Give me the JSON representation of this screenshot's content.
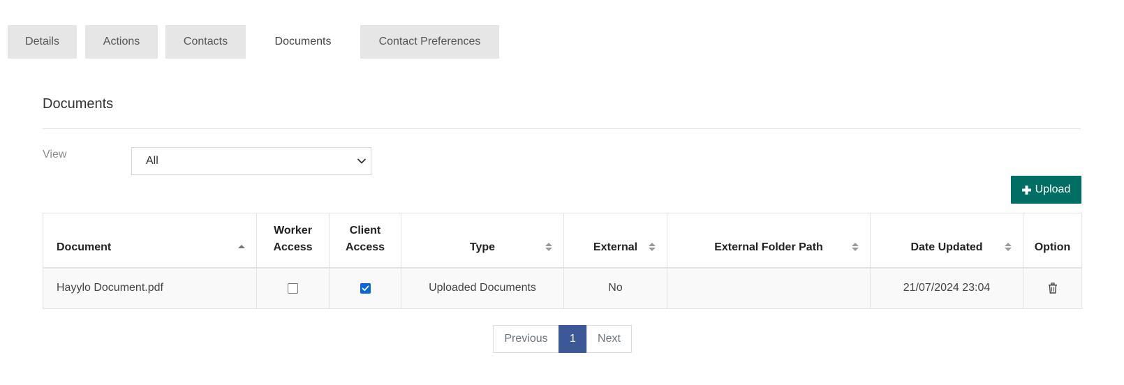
{
  "tabs": [
    {
      "label": "Details",
      "active": false
    },
    {
      "label": "Actions",
      "active": false
    },
    {
      "label": "Contacts",
      "active": false
    },
    {
      "label": "Documents",
      "active": true
    },
    {
      "label": "Contact Preferences",
      "active": false
    }
  ],
  "section": {
    "title": "Documents"
  },
  "filter": {
    "label": "View",
    "selected": "All"
  },
  "upload": {
    "label": "Upload",
    "icon": "plus-icon"
  },
  "table": {
    "columns": [
      {
        "label": "Document",
        "sort": "asc"
      },
      {
        "label": "Worker Access",
        "sort": "none"
      },
      {
        "label": "Client Access",
        "sort": "none"
      },
      {
        "label": "Type",
        "sort": "both"
      },
      {
        "label": "External",
        "sort": "both"
      },
      {
        "label": "External Folder Path",
        "sort": "both"
      },
      {
        "label": "Date Updated",
        "sort": "both"
      },
      {
        "label": "Option",
        "sort": "none"
      }
    ],
    "rows": [
      {
        "document": "Hayylo Document.pdf",
        "worker_access": false,
        "client_access": true,
        "type": "Uploaded Documents",
        "external": "No",
        "external_folder_path": "",
        "date_updated": "21/07/2024 23:04",
        "option_icon": "trash-icon"
      }
    ]
  },
  "pagination": {
    "previous": "Previous",
    "current": "1",
    "next": "Next"
  },
  "colors": {
    "upload_button": "#006e63",
    "page_current": "#3d5896",
    "checkbox_checked": "#0a66d6",
    "tab_inactive": "#e6e6e6"
  }
}
